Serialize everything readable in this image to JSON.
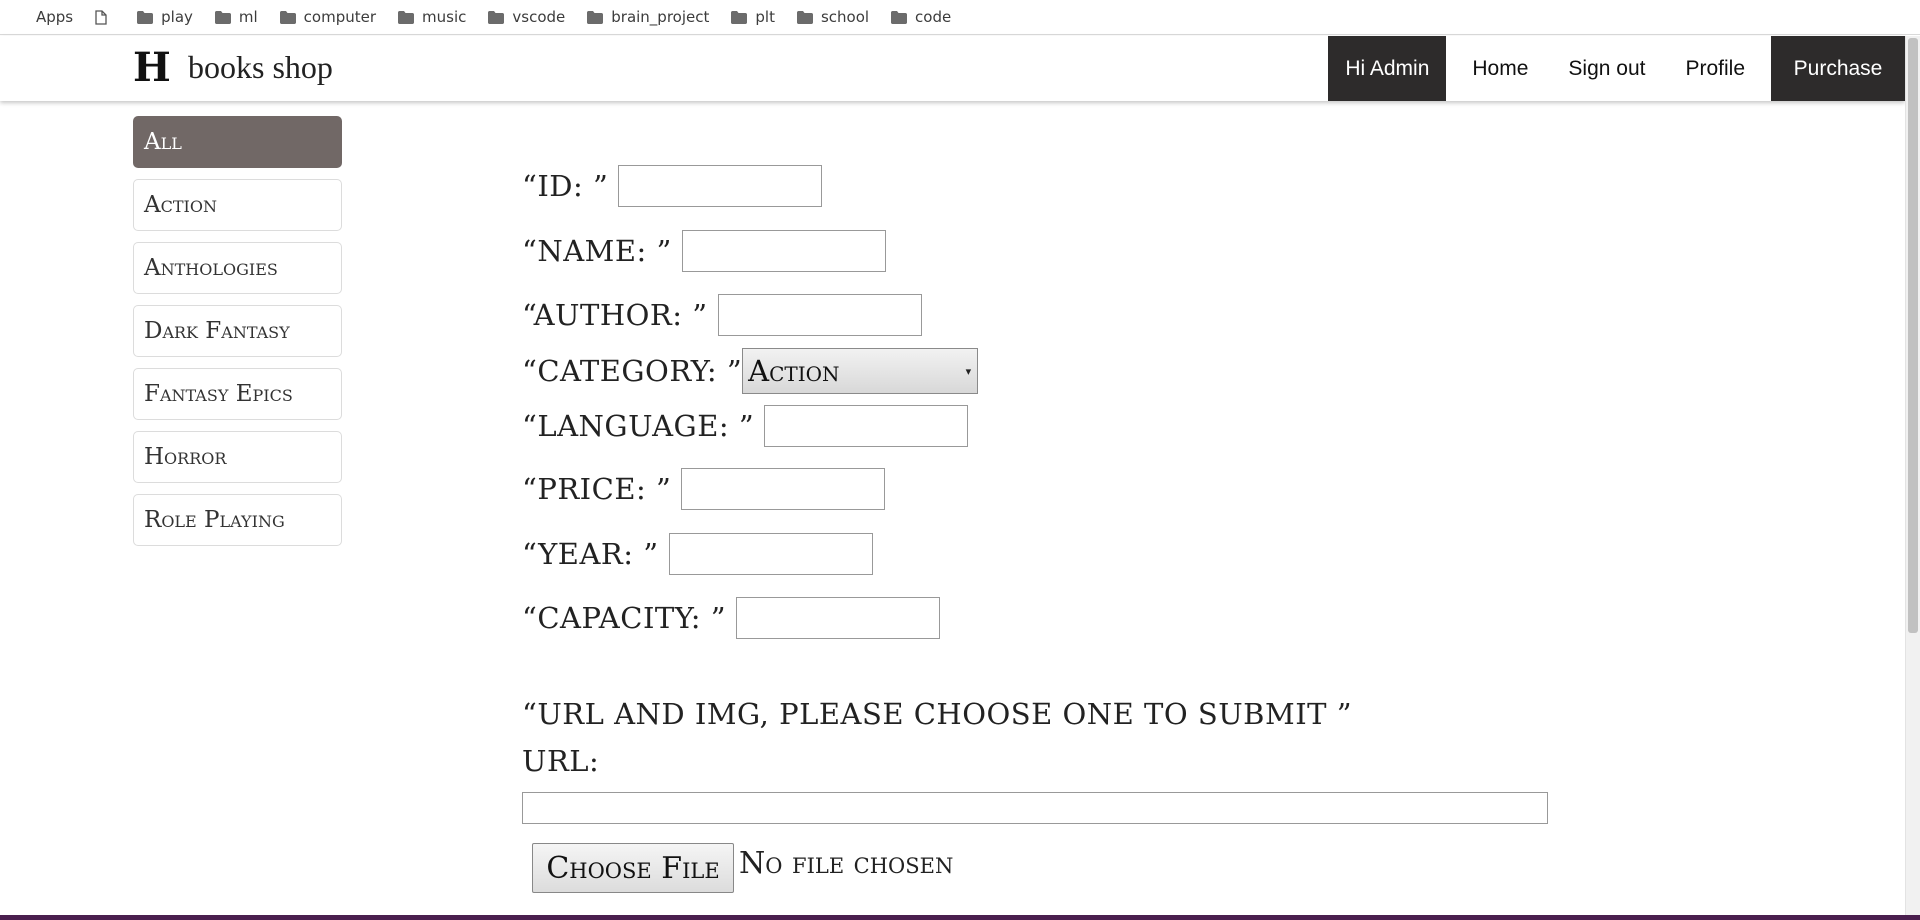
{
  "bookmarks": [
    {
      "label": "Apps",
      "icon": "apps-grid-icon"
    },
    {
      "label": "",
      "icon": "page-icon"
    },
    {
      "label": "play",
      "icon": "folder-icon"
    },
    {
      "label": "ml",
      "icon": "folder-icon"
    },
    {
      "label": "computer",
      "icon": "folder-icon"
    },
    {
      "label": "music",
      "icon": "folder-icon"
    },
    {
      "label": "vscode",
      "icon": "folder-icon"
    },
    {
      "label": "brain_project",
      "icon": "folder-icon"
    },
    {
      "label": "plt",
      "icon": "folder-icon"
    },
    {
      "label": "school",
      "icon": "folder-icon"
    },
    {
      "label": "code",
      "icon": "folder-icon"
    }
  ],
  "header": {
    "logo_letter": "H",
    "logo_text": "books shop",
    "nav": {
      "greeting": "Hi Admin",
      "home": "Home",
      "sign_out": "Sign out",
      "profile": "Profile",
      "purchase": "Purchase"
    }
  },
  "sidebar": {
    "categories": [
      "All",
      "Action",
      "Anthologies",
      "Dark Fantasy",
      "Fantasy Epics",
      "Horror",
      "Role Playing"
    ],
    "active": "All"
  },
  "form": {
    "id_label": "“ID: ”",
    "name_label": "“NAME: ”",
    "author_label": "“AUTHOR: ”",
    "category_label": "“CATEGORY: ”",
    "category_selected": "Action",
    "language_label": "“LANGUAGE: ”",
    "price_label": "“PRICE: ”",
    "year_label": "“YEAR: ”",
    "capacity_label": "“CAPACITY: ”",
    "url_img_label": "“URL AND IMG, PLEASE CHOOSE ONE TO SUBMIT ”",
    "url_label": "URL:",
    "choose_file": "Choose File",
    "file_status": "No file chosen"
  },
  "colors": {
    "nav_dark": "#2d2b2b",
    "sidebar_active": "#716866"
  }
}
